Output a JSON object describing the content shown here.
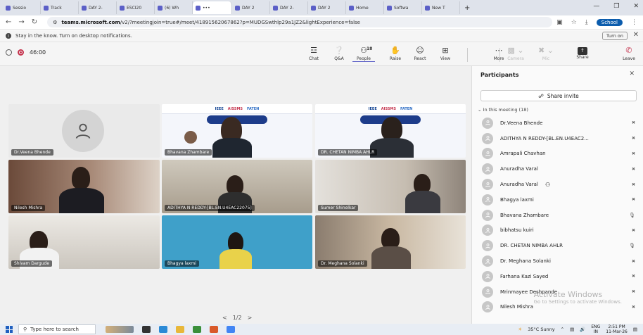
{
  "browser": {
    "tabs": [
      "Sessio",
      "Track",
      "DAY 2-",
      "ESCI20",
      "(6) Wh",
      "•••",
      "DAY 2",
      "DAY 2-",
      "DAY 2",
      "Home",
      "Softwa",
      "New T"
    ],
    "url_prefix": "teams.microsoft.com",
    "url_rest": "/v2/?meetingjoin=true#/meet/41891562067862?p=MUDGSwthlp29a1JZ2&lightExperience=false",
    "profile_label": "School"
  },
  "notification": {
    "text": "Stay in the know. Turn on desktop notifications.",
    "button": "Turn on"
  },
  "meeting": {
    "timer": "46:00",
    "controls": [
      {
        "label": "Chat",
        "icon": "chat-icon",
        "glyph": "☲"
      },
      {
        "label": "Q&A",
        "icon": "qa-icon",
        "glyph": "❔"
      },
      {
        "label": "People",
        "icon": "people-icon",
        "glyph": "⚇",
        "count": "18"
      },
      {
        "label": "Raise",
        "icon": "raise-hand-icon",
        "glyph": "✋"
      },
      {
        "label": "React",
        "icon": "react-icon",
        "glyph": "☺"
      },
      {
        "label": "View",
        "icon": "view-icon",
        "glyph": "⊞"
      }
    ],
    "more_label": "More",
    "camera_label": "Camera",
    "mic_label": "Mic",
    "share_label": "Share",
    "leave_label": "Leave"
  },
  "tiles": [
    "Dr.Veena Bhende",
    "Bhavana Zhambare",
    "DR. CHETAN NIMBA AHLR",
    "Nilesh Mishra",
    "ADITHYA N REDDY-[BL.EN.U4EAC22075]",
    "Sumer Shinelkar",
    "Shivam Dargude",
    "Bhagya laxmi",
    "Dr. Meghana Solanki"
  ],
  "slide_text": {
    "ieee": "IEEE",
    "aissms": "AISSMS",
    "faten": "FATEN"
  },
  "pager": {
    "label": "1/2",
    "prev": "<",
    "next": ">"
  },
  "participants": {
    "title": "Participants",
    "share_invite": "Share invite",
    "section": "In this meeting (18)",
    "list": [
      {
        "name": "Dr.Veena Bhende",
        "mic": "muted"
      },
      {
        "name": "ADITHYA N REDDY-[BL.EN.U4EAC2...",
        "mic": "muted"
      },
      {
        "name": "Amrapali Chavhan",
        "mic": "muted"
      },
      {
        "name": "Anuradha Varal",
        "mic": "muted"
      },
      {
        "name": "Anuradha Varal",
        "mic": "muted",
        "badge": "⚇"
      },
      {
        "name": "Bhagya laxmi",
        "mic": "muted"
      },
      {
        "name": "Bhavana Zhambare",
        "mic": "on"
      },
      {
        "name": "bibhatsu kuiri",
        "mic": "muted"
      },
      {
        "name": "DR. CHETAN NIMBA AHLR",
        "mic": "on"
      },
      {
        "name": "Dr. Meghana Solanki",
        "mic": "muted"
      },
      {
        "name": "Farhana Kazi Sayed",
        "mic": "muted"
      },
      {
        "name": "Mrinmayee Deshpande",
        "mic": "muted"
      },
      {
        "name": "Nilesh Mishra",
        "mic": "muted"
      }
    ]
  },
  "watermark": {
    "title": "Activate Windows",
    "subtitle": "Go to Settings to activate Windows."
  },
  "taskbar": {
    "search_placeholder": "Type here to search",
    "weather": "35°C Sunny",
    "lang1": "ENG",
    "lang2": "IN",
    "time": "2:51 PM",
    "date": "11-Mar-26"
  }
}
